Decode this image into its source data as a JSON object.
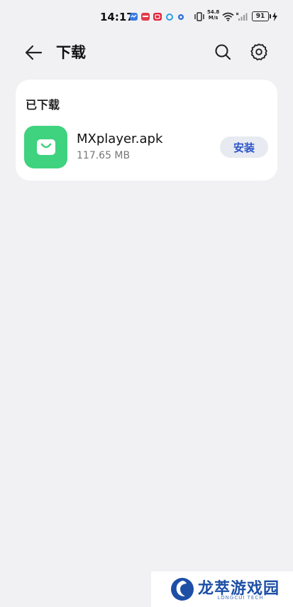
{
  "status_bar": {
    "time": "14:17",
    "net_speed_value": "54.8",
    "net_speed_unit": "M/s",
    "battery": "91"
  },
  "header": {
    "title": "下载"
  },
  "downloads": {
    "section_title": "已下载",
    "items": [
      {
        "name": "MXplayer.apk",
        "size": "117.65 MB",
        "action": "安装",
        "icon_color": "#3fd27f"
      }
    ]
  },
  "watermark": {
    "text": "龙萃游戏园",
    "subtext": "LONGCUI TECH"
  },
  "colors": {
    "background": "#f1f1f3",
    "accent": "#2b55c9",
    "app_icon": "#3fd27f"
  }
}
